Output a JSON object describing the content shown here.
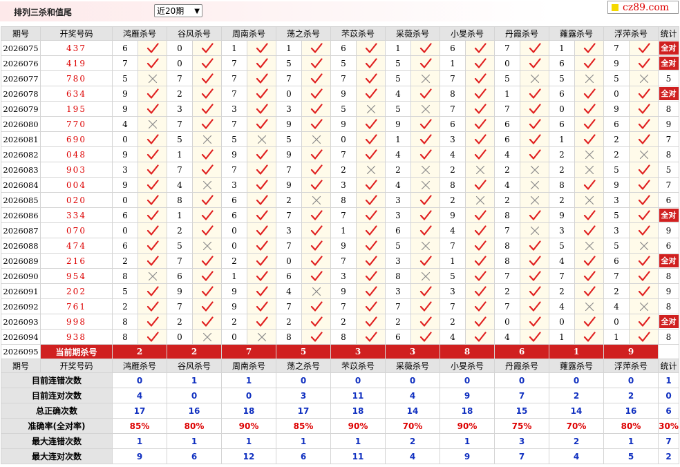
{
  "title": "排列三杀和值尾",
  "range_select": {
    "value": "近20期",
    "arrow": "▼"
  },
  "logo": {
    "text": "cz89.com",
    "accent": "#f5d900"
  },
  "colors": {
    "accent_red": "#d02020",
    "stat_blue": "#1030c0",
    "header_gray": "#e4e4e4",
    "mark_bg": "#fffbea"
  },
  "header": {
    "issue": "期号",
    "draw": "开奖号码",
    "experts": [
      "鸿雁杀号",
      "谷风杀号",
      "周南杀号",
      "荡之杀号",
      "芣苡杀号",
      "采薇杀号",
      "小旻杀号",
      "丹霞杀号",
      "蕹露杀号",
      "浮萍杀号"
    ],
    "total": "统计"
  },
  "rows": [
    {
      "issue": "2026075",
      "draw": "437",
      "kills": [
        [
          "6",
          1
        ],
        [
          "0",
          1
        ],
        [
          "1",
          1
        ],
        [
          "1",
          1
        ],
        [
          "6",
          1
        ],
        [
          "1",
          1
        ],
        [
          "6",
          1
        ],
        [
          "7",
          1
        ],
        [
          "1",
          1
        ],
        [
          "7",
          1
        ]
      ],
      "total": "全对"
    },
    {
      "issue": "2026076",
      "draw": "419",
      "kills": [
        [
          "7",
          1
        ],
        [
          "0",
          1
        ],
        [
          "7",
          1
        ],
        [
          "5",
          1
        ],
        [
          "5",
          1
        ],
        [
          "5",
          1
        ],
        [
          "1",
          1
        ],
        [
          "0",
          1
        ],
        [
          "6",
          1
        ],
        [
          "9",
          1
        ]
      ],
      "total": "全对"
    },
    {
      "issue": "2026077",
      "draw": "780",
      "kills": [
        [
          "5",
          0
        ],
        [
          "7",
          1
        ],
        [
          "7",
          1
        ],
        [
          "7",
          1
        ],
        [
          "7",
          1
        ],
        [
          "5",
          0
        ],
        [
          "7",
          1
        ],
        [
          "5",
          0
        ],
        [
          "5",
          0
        ],
        [
          "5",
          0
        ]
      ],
      "total": "5"
    },
    {
      "issue": "2026078",
      "draw": "634",
      "kills": [
        [
          "9",
          1
        ],
        [
          "2",
          1
        ],
        [
          "7",
          1
        ],
        [
          "0",
          1
        ],
        [
          "9",
          1
        ],
        [
          "4",
          1
        ],
        [
          "8",
          1
        ],
        [
          "1",
          1
        ],
        [
          "6",
          1
        ],
        [
          "0",
          1
        ]
      ],
      "total": "全对"
    },
    {
      "issue": "2026079",
      "draw": "195",
      "kills": [
        [
          "9",
          1
        ],
        [
          "3",
          1
        ],
        [
          "3",
          1
        ],
        [
          "3",
          1
        ],
        [
          "5",
          0
        ],
        [
          "5",
          0
        ],
        [
          "7",
          1
        ],
        [
          "7",
          1
        ],
        [
          "0",
          1
        ],
        [
          "9",
          1
        ]
      ],
      "total": "8"
    },
    {
      "issue": "2026080",
      "draw": "770",
      "kills": [
        [
          "4",
          0
        ],
        [
          "7",
          1
        ],
        [
          "7",
          1
        ],
        [
          "9",
          1
        ],
        [
          "9",
          1
        ],
        [
          "9",
          1
        ],
        [
          "6",
          1
        ],
        [
          "6",
          1
        ],
        [
          "6",
          1
        ],
        [
          "6",
          1
        ]
      ],
      "total": "9"
    },
    {
      "issue": "2026081",
      "draw": "690",
      "kills": [
        [
          "0",
          1
        ],
        [
          "5",
          0
        ],
        [
          "5",
          0
        ],
        [
          "5",
          0
        ],
        [
          "0",
          1
        ],
        [
          "1",
          1
        ],
        [
          "3",
          1
        ],
        [
          "6",
          1
        ],
        [
          "1",
          1
        ],
        [
          "2",
          1
        ]
      ],
      "total": "7"
    },
    {
      "issue": "2026082",
      "draw": "048",
      "kills": [
        [
          "9",
          1
        ],
        [
          "1",
          1
        ],
        [
          "9",
          1
        ],
        [
          "9",
          1
        ],
        [
          "7",
          1
        ],
        [
          "4",
          1
        ],
        [
          "4",
          1
        ],
        [
          "4",
          1
        ],
        [
          "2",
          0
        ],
        [
          "2",
          0
        ]
      ],
      "total": "8"
    },
    {
      "issue": "2026083",
      "draw": "903",
      "kills": [
        [
          "3",
          1
        ],
        [
          "7",
          1
        ],
        [
          "7",
          1
        ],
        [
          "7",
          1
        ],
        [
          "2",
          0
        ],
        [
          "2",
          0
        ],
        [
          "2",
          0
        ],
        [
          "2",
          0
        ],
        [
          "2",
          0
        ],
        [
          "5",
          1
        ]
      ],
      "total": "5"
    },
    {
      "issue": "2026084",
      "draw": "004",
      "kills": [
        [
          "9",
          1
        ],
        [
          "4",
          0
        ],
        [
          "3",
          1
        ],
        [
          "9",
          1
        ],
        [
          "3",
          1
        ],
        [
          "4",
          0
        ],
        [
          "8",
          1
        ],
        [
          "4",
          0
        ],
        [
          "8",
          1
        ],
        [
          "9",
          1
        ]
      ],
      "total": "7"
    },
    {
      "issue": "2026085",
      "draw": "020",
      "kills": [
        [
          "0",
          1
        ],
        [
          "8",
          1
        ],
        [
          "6",
          1
        ],
        [
          "2",
          0
        ],
        [
          "8",
          1
        ],
        [
          "3",
          1
        ],
        [
          "2",
          0
        ],
        [
          "2",
          0
        ],
        [
          "2",
          0
        ],
        [
          "3",
          1
        ]
      ],
      "total": "6"
    },
    {
      "issue": "2026086",
      "draw": "334",
      "kills": [
        [
          "6",
          1
        ],
        [
          "1",
          1
        ],
        [
          "6",
          1
        ],
        [
          "7",
          1
        ],
        [
          "7",
          1
        ],
        [
          "3",
          1
        ],
        [
          "9",
          1
        ],
        [
          "8",
          1
        ],
        [
          "9",
          1
        ],
        [
          "5",
          1
        ]
      ],
      "total": "全对"
    },
    {
      "issue": "2026087",
      "draw": "070",
      "kills": [
        [
          "0",
          1
        ],
        [
          "2",
          1
        ],
        [
          "0",
          1
        ],
        [
          "3",
          1
        ],
        [
          "1",
          1
        ],
        [
          "6",
          1
        ],
        [
          "4",
          1
        ],
        [
          "7",
          0
        ],
        [
          "3",
          1
        ],
        [
          "3",
          1
        ]
      ],
      "total": "9"
    },
    {
      "issue": "2026088",
      "draw": "474",
      "kills": [
        [
          "6",
          1
        ],
        [
          "5",
          0
        ],
        [
          "0",
          1
        ],
        [
          "7",
          1
        ],
        [
          "9",
          1
        ],
        [
          "5",
          0
        ],
        [
          "7",
          1
        ],
        [
          "8",
          1
        ],
        [
          "5",
          0
        ],
        [
          "5",
          0
        ]
      ],
      "total": "6"
    },
    {
      "issue": "2026089",
      "draw": "216",
      "kills": [
        [
          "2",
          1
        ],
        [
          "7",
          1
        ],
        [
          "2",
          1
        ],
        [
          "0",
          1
        ],
        [
          "7",
          1
        ],
        [
          "3",
          1
        ],
        [
          "1",
          1
        ],
        [
          "8",
          1
        ],
        [
          "4",
          1
        ],
        [
          "6",
          1
        ]
      ],
      "total": "全对"
    },
    {
      "issue": "2026090",
      "draw": "954",
      "kills": [
        [
          "8",
          0
        ],
        [
          "6",
          1
        ],
        [
          "1",
          1
        ],
        [
          "6",
          1
        ],
        [
          "3",
          1
        ],
        [
          "8",
          0
        ],
        [
          "5",
          1
        ],
        [
          "7",
          1
        ],
        [
          "7",
          1
        ],
        [
          "7",
          1
        ]
      ],
      "total": "8"
    },
    {
      "issue": "2026091",
      "draw": "202",
      "kills": [
        [
          "5",
          1
        ],
        [
          "9",
          1
        ],
        [
          "9",
          1
        ],
        [
          "4",
          0
        ],
        [
          "9",
          1
        ],
        [
          "3",
          1
        ],
        [
          "3",
          1
        ],
        [
          "2",
          1
        ],
        [
          "2",
          1
        ],
        [
          "2",
          1
        ]
      ],
      "total": "9"
    },
    {
      "issue": "2026092",
      "draw": "761",
      "kills": [
        [
          "2",
          1
        ],
        [
          "7",
          1
        ],
        [
          "9",
          1
        ],
        [
          "7",
          1
        ],
        [
          "7",
          1
        ],
        [
          "7",
          1
        ],
        [
          "7",
          1
        ],
        [
          "7",
          1
        ],
        [
          "4",
          0
        ],
        [
          "4",
          0
        ]
      ],
      "total": "8"
    },
    {
      "issue": "2026093",
      "draw": "998",
      "kills": [
        [
          "8",
          1
        ],
        [
          "2",
          1
        ],
        [
          "2",
          1
        ],
        [
          "2",
          1
        ],
        [
          "2",
          1
        ],
        [
          "2",
          1
        ],
        [
          "2",
          1
        ],
        [
          "0",
          1
        ],
        [
          "0",
          1
        ],
        [
          "0",
          1
        ]
      ],
      "total": "全对"
    },
    {
      "issue": "2026094",
      "draw": "938",
      "kills": [
        [
          "8",
          1
        ],
        [
          "0",
          0
        ],
        [
          "0",
          0
        ],
        [
          "8",
          1
        ],
        [
          "8",
          1
        ],
        [
          "6",
          1
        ],
        [
          "4",
          1
        ],
        [
          "4",
          1
        ],
        [
          "1",
          1
        ],
        [
          "1",
          1
        ]
      ],
      "total": "8"
    }
  ],
  "current": {
    "issue": "2026095",
    "label": "当前期杀号",
    "kills": [
      "2",
      "2",
      "7",
      "5",
      "3",
      "3",
      "8",
      "6",
      "1",
      "9"
    ]
  },
  "stats": [
    {
      "label": "目前连错次数",
      "values": [
        "0",
        "1",
        "1",
        "0",
        "0",
        "0",
        "0",
        "0",
        "0",
        "0",
        "1"
      ],
      "color": "b"
    },
    {
      "label": "目前连对次数",
      "values": [
        "4",
        "0",
        "0",
        "3",
        "11",
        "4",
        "9",
        "7",
        "2",
        "2",
        "0"
      ],
      "color": "b"
    },
    {
      "label": "总正确次数",
      "values": [
        "17",
        "16",
        "18",
        "17",
        "18",
        "14",
        "18",
        "15",
        "14",
        "16",
        "6"
      ],
      "color": "b"
    },
    {
      "label": "准确率(全对率)",
      "values": [
        "85%",
        "80%",
        "90%",
        "85%",
        "90%",
        "70%",
        "90%",
        "75%",
        "70%",
        "80%",
        "30%"
      ],
      "color": "r"
    },
    {
      "label": "最大连错次数",
      "values": [
        "1",
        "1",
        "1",
        "1",
        "1",
        "2",
        "1",
        "3",
        "2",
        "1",
        "7"
      ],
      "color": "b"
    },
    {
      "label": "最大连对次数",
      "values": [
        "9",
        "6",
        "12",
        "6",
        "11",
        "4",
        "9",
        "7",
        "4",
        "5",
        "2"
      ],
      "color": "b"
    }
  ]
}
